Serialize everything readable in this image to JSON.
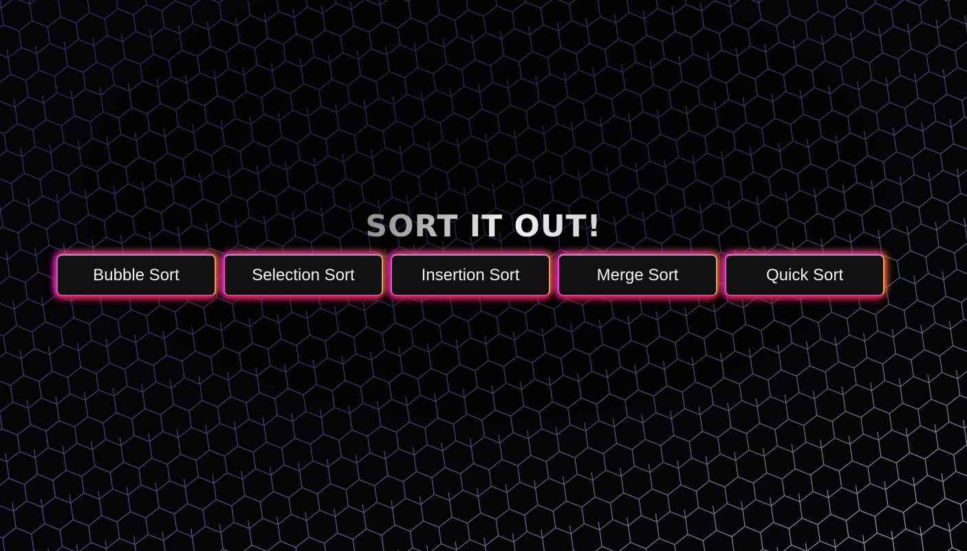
{
  "page": {
    "title": "SORT IT OUT!"
  },
  "buttons": [
    {
      "label": "Bubble Sort"
    },
    {
      "label": "Selection Sort"
    },
    {
      "label": "Insertion Sort"
    },
    {
      "label": "Merge Sort"
    },
    {
      "label": "Quick Sort"
    }
  ],
  "colors": {
    "background": "#050406",
    "hex_grid_left": "#6a5cc0",
    "hex_grid_right": "#cfcfd8",
    "button_fill": "#111112",
    "glow_magenta": "#e428c8",
    "glow_orange": "#ff9628",
    "glow_red": "#d21428"
  }
}
